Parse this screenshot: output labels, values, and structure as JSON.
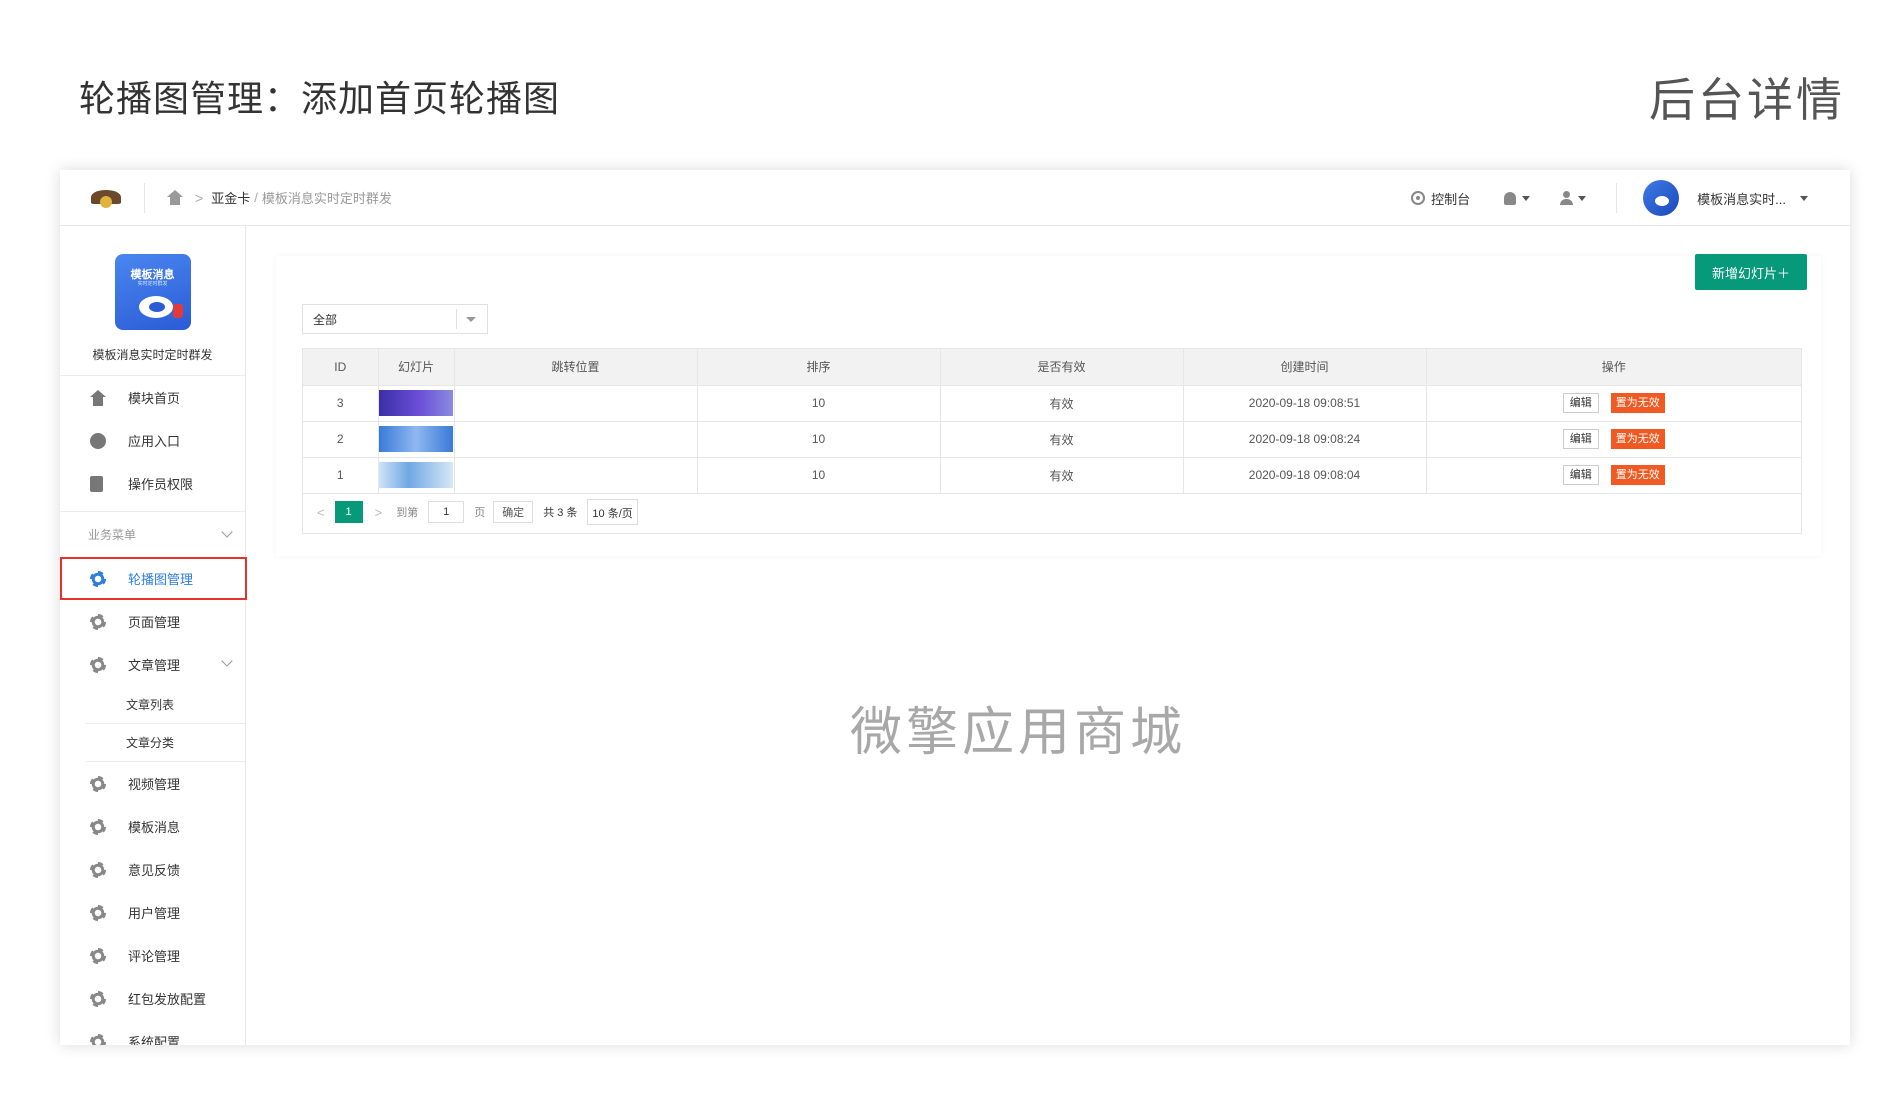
{
  "header": {
    "title": "轮播图管理：添加首页轮播图",
    "subtitle": "后台详情"
  },
  "topbar": {
    "breadcrumb_sep": ">",
    "breadcrumb_1": "亚金卡",
    "breadcrumb_slash": "/",
    "breadcrumb_2": "模板消息实时定时群发",
    "console_label": "控制台",
    "account_name": "模板消息实时..."
  },
  "sidebar": {
    "app_logo_title": "模板消息",
    "app_logo_tagline": "实时定时群发",
    "app_name": "模板消息实时定时群发",
    "top_items": [
      {
        "label": "模块首页",
        "icon": "home-icon"
      },
      {
        "label": "应用入口",
        "icon": "chat-icon"
      },
      {
        "label": "操作员权限",
        "icon": "document-icon"
      }
    ],
    "section_label": "业务菜单",
    "items": [
      {
        "label": "轮播图管理",
        "icon": "gear-icon",
        "active": true
      },
      {
        "label": "页面管理",
        "icon": "gear-icon"
      },
      {
        "label": "文章管理",
        "icon": "gear-icon",
        "expanded": true
      }
    ],
    "sub_items": [
      {
        "label": "文章列表"
      },
      {
        "label": "文章分类"
      }
    ],
    "items_after": [
      {
        "label": "视频管理",
        "icon": "gear-icon"
      },
      {
        "label": "模板消息",
        "icon": "gear-icon"
      },
      {
        "label": "意见反馈",
        "icon": "gear-icon"
      },
      {
        "label": "用户管理",
        "icon": "gear-icon"
      },
      {
        "label": "评论管理",
        "icon": "gear-icon"
      },
      {
        "label": "红包发放配置",
        "icon": "gear-icon"
      },
      {
        "label": "系统配置",
        "icon": "gear-icon"
      }
    ]
  },
  "main": {
    "add_button_label": "新增幻灯片＋",
    "filter_value": "全部",
    "columns": [
      "ID",
      "幻灯片",
      "跳转位置",
      "排序",
      "是否有效",
      "创建时间",
      "操作"
    ],
    "rows": [
      {
        "id": "3",
        "link": "",
        "sort": "10",
        "valid": "有效",
        "created": "2020-09-18 09:08:51",
        "edit_label": "编辑",
        "invalid_label": "置为无效"
      },
      {
        "id": "2",
        "link": "",
        "sort": "10",
        "valid": "有效",
        "created": "2020-09-18 09:08:24",
        "edit_label": "编辑",
        "invalid_label": "置为无效"
      },
      {
        "id": "1",
        "link": "",
        "sort": "10",
        "valid": "有效",
        "created": "2020-09-18 09:08:04",
        "edit_label": "编辑",
        "invalid_label": "置为无效"
      }
    ],
    "pagination": {
      "prev": "<",
      "current": "1",
      "next": ">",
      "goto_label": "到第",
      "page_input": "1",
      "page_label": "页",
      "confirm_label": "确定",
      "total_label": "共 3 条",
      "page_size": "10 条/页"
    }
  },
  "watermark": "微擎应用商城",
  "colors": {
    "primary_green": "#079a7a",
    "active_blue": "#2f7de1",
    "danger_orange": "#f05a22",
    "highlight_red": "#e5322d"
  }
}
